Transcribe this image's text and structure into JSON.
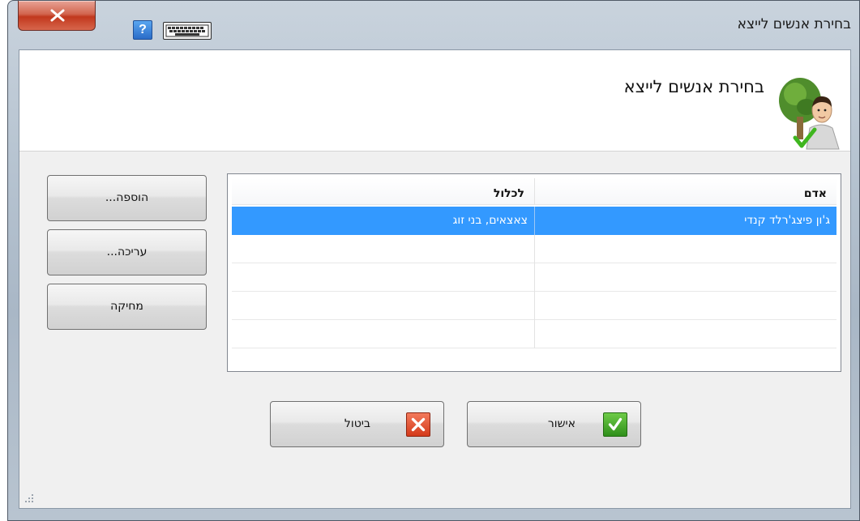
{
  "window": {
    "title": "בחירת אנשים לייצא"
  },
  "titlebar": {
    "close_icon": "close-x-icon",
    "help_label": "?",
    "help_icon": "help-icon",
    "keyboard_icon": "keyboard-icon"
  },
  "header": {
    "title": "בחירת אנשים לייצא",
    "avatar_icon": "tree-person-check-icon"
  },
  "list": {
    "columns": [
      "אדם",
      "לכלול"
    ],
    "rows": [
      {
        "person": "ג'ון פיצג'רלד קנדי",
        "include": "צאצאים, בני זוג",
        "selected": true
      },
      {
        "person": "",
        "include": "",
        "selected": false
      },
      {
        "person": "",
        "include": "",
        "selected": false
      },
      {
        "person": "",
        "include": "",
        "selected": false
      },
      {
        "person": "",
        "include": "",
        "selected": false
      }
    ]
  },
  "side_buttons": {
    "add_label": "הוספה...",
    "edit_label": "עריכה...",
    "delete_label": "מחיקה"
  },
  "dialog_buttons": {
    "ok_label": "אישור",
    "ok_icon": "checkmark-icon",
    "cancel_label": "ביטול",
    "cancel_icon": "x-icon"
  },
  "colors": {
    "selection": "#3399ff",
    "ok_green": "#2f8f1a",
    "cancel_red": "#d43a1a",
    "close_red": "#c1381d"
  }
}
